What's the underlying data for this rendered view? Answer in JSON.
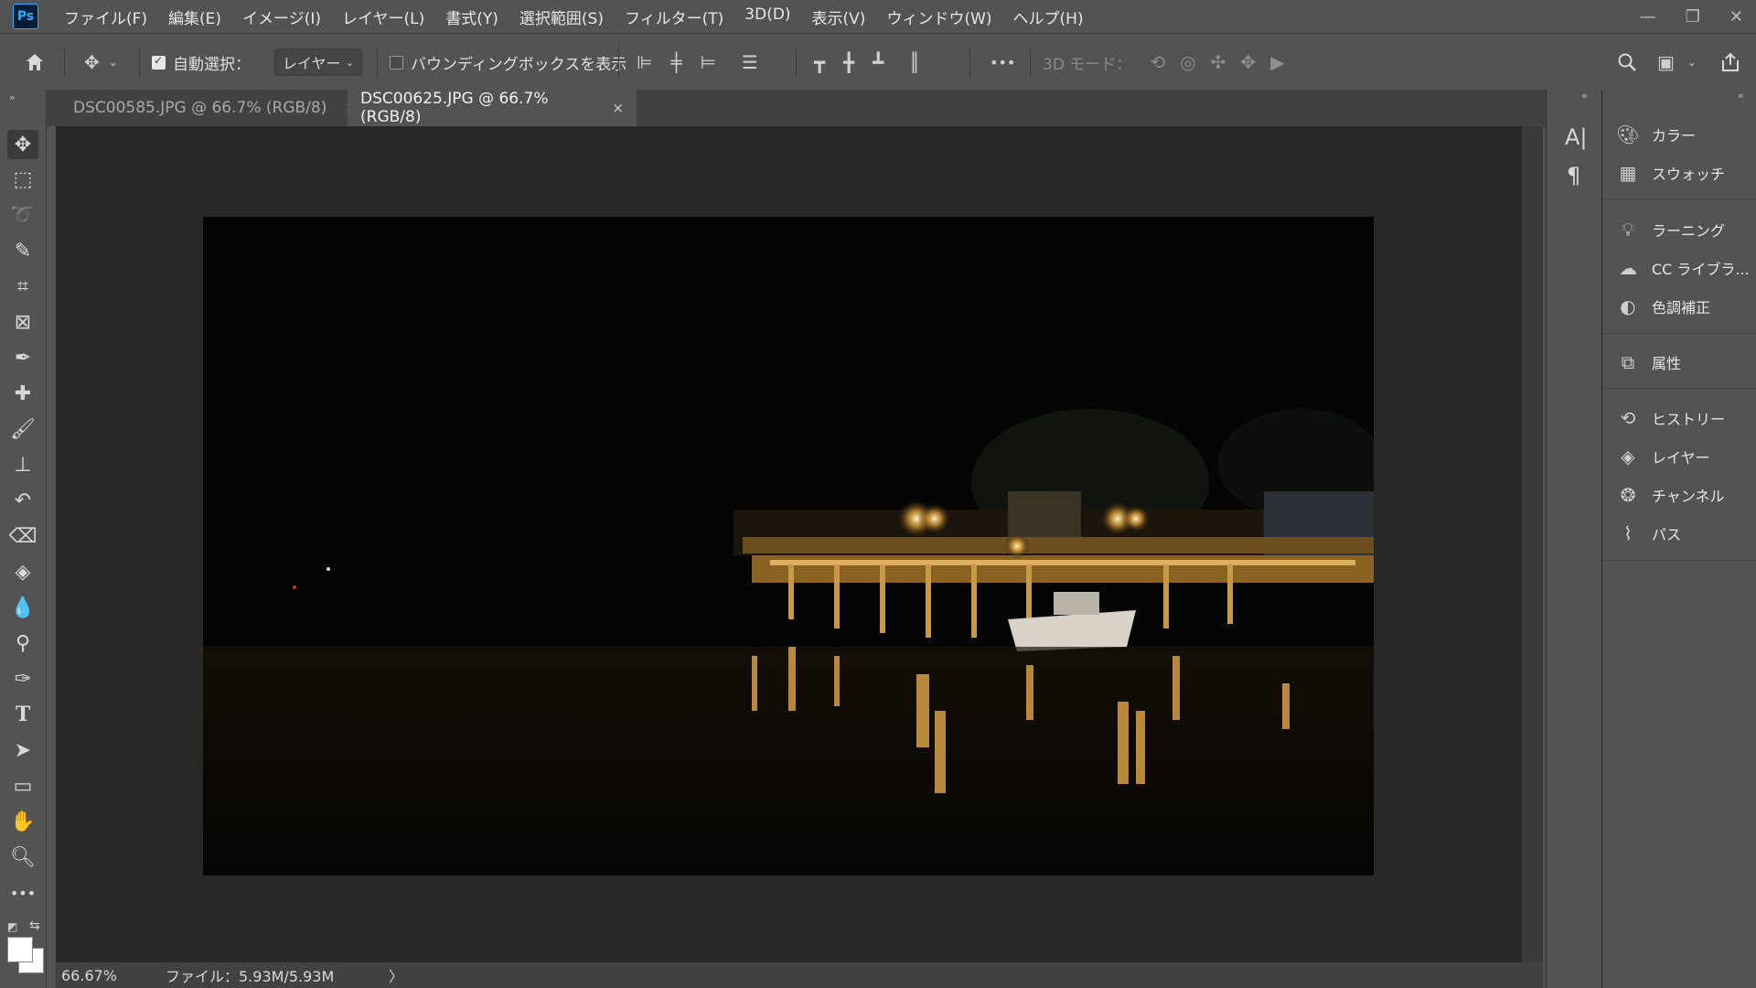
{
  "app": {
    "logo_text": "Ps"
  },
  "menu": [
    "ファイル(F)",
    "編集(E)",
    "イメージ(I)",
    "レイヤー(L)",
    "書式(Y)",
    "選択範囲(S)",
    "フィルター(T)",
    "3D(D)",
    "表示(V)",
    "ウィンドウ(W)",
    "ヘルプ(H)"
  ],
  "options": {
    "auto_select_label": "自動選択：",
    "auto_select_checked": true,
    "layer_select_value": "レイヤー",
    "bounding_box_label": "バウンディングボックスを表示",
    "mode_3d_label": "3D モード：",
    "more_label": "•••"
  },
  "tabs": [
    {
      "label": "DSC00585.JPG @ 66.7% (RGB/8)",
      "close": "×",
      "active": false
    },
    {
      "label": "DSC00625.JPG @ 66.7% (RGB/8)",
      "close": "×",
      "active": true
    }
  ],
  "status": {
    "zoom": "66.67%",
    "file_info": "ファイル：5.93M/5.93M",
    "arrow": "〉"
  },
  "panels": [
    {
      "label": "カラー",
      "icon": "palette-icon"
    },
    {
      "label": "スウォッチ",
      "icon": "grid-icon"
    },
    {
      "label": "ラーニング",
      "icon": "bulb-icon"
    },
    {
      "label": "CC ライブラ...",
      "icon": "cc-libraries-icon"
    },
    {
      "label": "色調補正",
      "icon": "adjustments-icon"
    },
    {
      "label": "属性",
      "icon": "properties-icon"
    },
    {
      "label": "ヒストリー",
      "icon": "history-icon"
    },
    {
      "label": "レイヤー",
      "icon": "layers-icon"
    },
    {
      "label": "チャンネル",
      "icon": "channels-icon"
    },
    {
      "label": "パス",
      "icon": "paths-icon"
    }
  ],
  "colors": {
    "accent": "#31a8ff",
    "bg": "#535353",
    "canvas": "#282828"
  }
}
